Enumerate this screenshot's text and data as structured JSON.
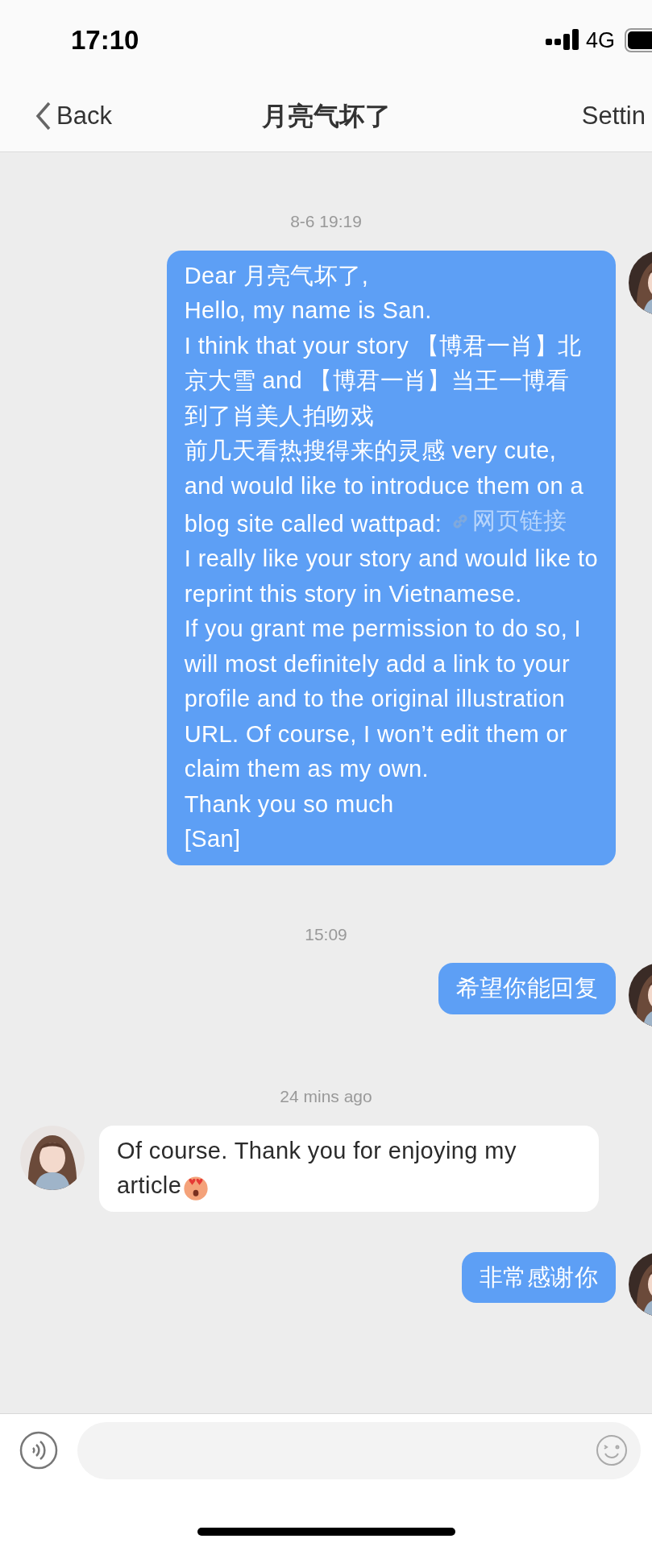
{
  "status_bar": {
    "time": "17:10",
    "network": "4G"
  },
  "nav": {
    "back": "Back",
    "title": "月亮气坏了",
    "settings": "Settin"
  },
  "messages": [
    {
      "kind": "time",
      "text": "8-6 19:19"
    },
    {
      "kind": "sent",
      "lines": [
        {
          "text": "Dear 月亮气坏了,"
        },
        {
          "text": "Hello, my name is San."
        },
        {
          "text": "I think that your story 【博君一肖】北"
        },
        {
          "text": "京大雪 and 【博君一肖】当王一博看"
        },
        {
          "text": "到了肖美人拍吻戏"
        },
        {
          "text": "前几天看热搜得来的灵感  very cute,"
        },
        {
          "text": "and would like to introduce them on a"
        },
        {
          "text": "blog site called wattpad:",
          "link": "网页链接"
        },
        {
          "text": "I really like your story and would like to"
        },
        {
          "text": "reprint this story in Vietnamese."
        },
        {
          "text": "If you grant me permission to do so, I"
        },
        {
          "text": "will most definitely add a link to your"
        },
        {
          "text": "profile and to the original illustration"
        },
        {
          "text": "URL. Of course, I won’t edit them or"
        },
        {
          "text": "claim them as my own."
        },
        {
          "text": "Thank you so much"
        },
        {
          "text": "[San]"
        }
      ]
    },
    {
      "kind": "time",
      "text": "15:09"
    },
    {
      "kind": "sent",
      "lines": [
        {
          "text": "希望你能回复"
        }
      ]
    },
    {
      "kind": "time",
      "text": "24 mins ago"
    },
    {
      "kind": "received",
      "lines": [
        {
          "text": "Of course. Thank you for enjoying my"
        },
        {
          "text": "article",
          "emoji": true
        }
      ]
    },
    {
      "kind": "sent",
      "lines": [
        {
          "text": "非常感谢你"
        }
      ]
    }
  ]
}
